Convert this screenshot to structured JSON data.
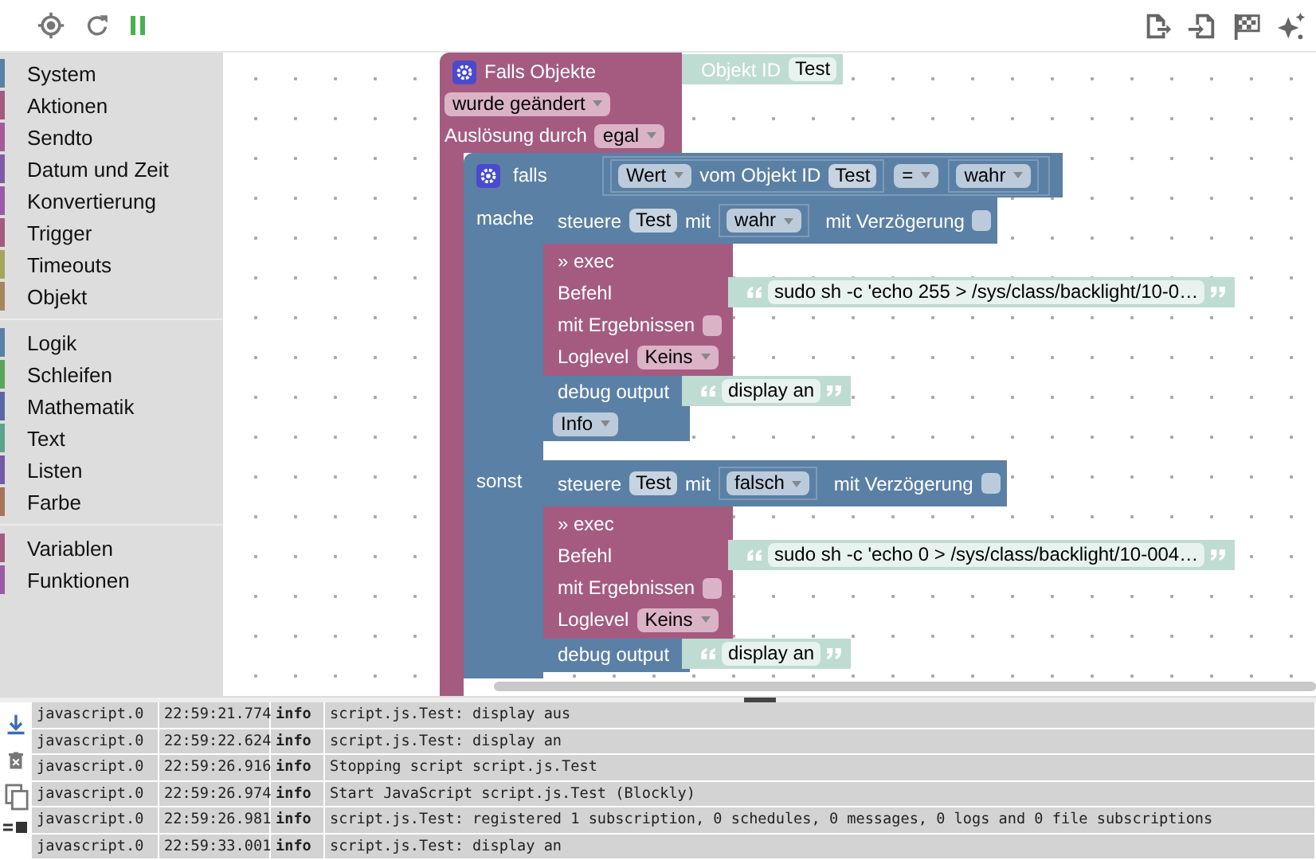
{
  "category_groups": [
    {
      "items": [
        {
          "label": "System",
          "color": "#5b80a5"
        },
        {
          "label": "Aktionen",
          "color": "#a55b80"
        },
        {
          "label": "Sendto",
          "color": "#a55b99"
        },
        {
          "label": "Datum und Zeit",
          "color": "#805ba5"
        },
        {
          "label": "Konvertierung",
          "color": "#995ba5"
        },
        {
          "label": "Trigger",
          "color": "#a55b80"
        },
        {
          "label": "Timeouts",
          "color": "#a5a55b"
        },
        {
          "label": "Objekt",
          "color": "#a5865b"
        }
      ]
    },
    {
      "items": [
        {
          "label": "Logik",
          "color": "#5b80a5"
        },
        {
          "label": "Schleifen",
          "color": "#5ba55b"
        },
        {
          "label": "Mathematik",
          "color": "#5b67a5"
        },
        {
          "label": "Text",
          "color": "#5ba58c"
        },
        {
          "label": "Listen",
          "color": "#745ba5"
        },
        {
          "label": "Farbe",
          "color": "#a5745b"
        }
      ]
    },
    {
      "items": [
        {
          "label": "Variablen",
          "color": "#a55b80"
        },
        {
          "label": "Funktionen",
          "color": "#995ba5"
        }
      ]
    }
  ],
  "trigger_block": {
    "title": "Falls Objekte",
    "object_label": "Objekt ID",
    "object_id": "Test",
    "event": "wurde geändert",
    "trigger_label": "Auslösung durch",
    "trigger_value": "egal"
  },
  "if_block": {
    "label": "falls",
    "condition": {
      "property": "Wert",
      "label": "vom Objekt ID",
      "object_id": "Test",
      "operator": "=",
      "compare": "wahr"
    },
    "branches": [
      {
        "label": "mache",
        "control": {
          "label": "steuere",
          "object": "Test",
          "with": "mit",
          "value": "wahr",
          "delay_label": "mit Verzögerung",
          "delay": false
        },
        "exec": {
          "title": "» exec",
          "command_label": "Befehl",
          "command": "sudo sh -c 'echo 255 > /sys/class/backlight/10-0…",
          "results_label": "mit Ergebnissen",
          "results": false,
          "loglevel_label": "Loglevel",
          "loglevel": "Keins"
        },
        "debug": {
          "label": "debug output",
          "text": "display an",
          "log_level": "Info"
        }
      },
      {
        "label": "sonst",
        "control": {
          "label": "steuere",
          "object": "Test",
          "with": "mit",
          "value": "falsch",
          "delay_label": "mit Verzögerung",
          "delay": false
        },
        "exec": {
          "title": "» exec",
          "command_label": "Befehl",
          "command": "sudo sh -c 'echo 0 > /sys/class/backlight/10-004…",
          "results_label": "mit Ergebnissen",
          "results": false,
          "loglevel_label": "Loglevel",
          "loglevel": "Keins"
        },
        "debug": {
          "label": "debug output",
          "text": "display an"
        }
      }
    ]
  },
  "log": {
    "rows": [
      {
        "source": "javascript.0",
        "time": "22:59:21.774",
        "severity": "info",
        "message": "script.js.Test: display aus"
      },
      {
        "source": "javascript.0",
        "time": "22:59:22.624",
        "severity": "info",
        "message": "script.js.Test: display an"
      },
      {
        "source": "javascript.0",
        "time": "22:59:26.916",
        "severity": "info",
        "message": "Stopping script script.js.Test"
      },
      {
        "source": "javascript.0",
        "time": "22:59:26.974",
        "severity": "info",
        "message": "Start JavaScript script.js.Test (Blockly)"
      },
      {
        "source": "javascript.0",
        "time": "22:59:26.981",
        "severity": "info",
        "message": "script.js.Test: registered 1 subscription, 0 schedules, 0 messages, 0 logs and 0 file subscriptions"
      },
      {
        "source": "javascript.0",
        "time": "22:59:33.001",
        "severity": "info",
        "message": "script.js.Test: display an"
      }
    ]
  }
}
